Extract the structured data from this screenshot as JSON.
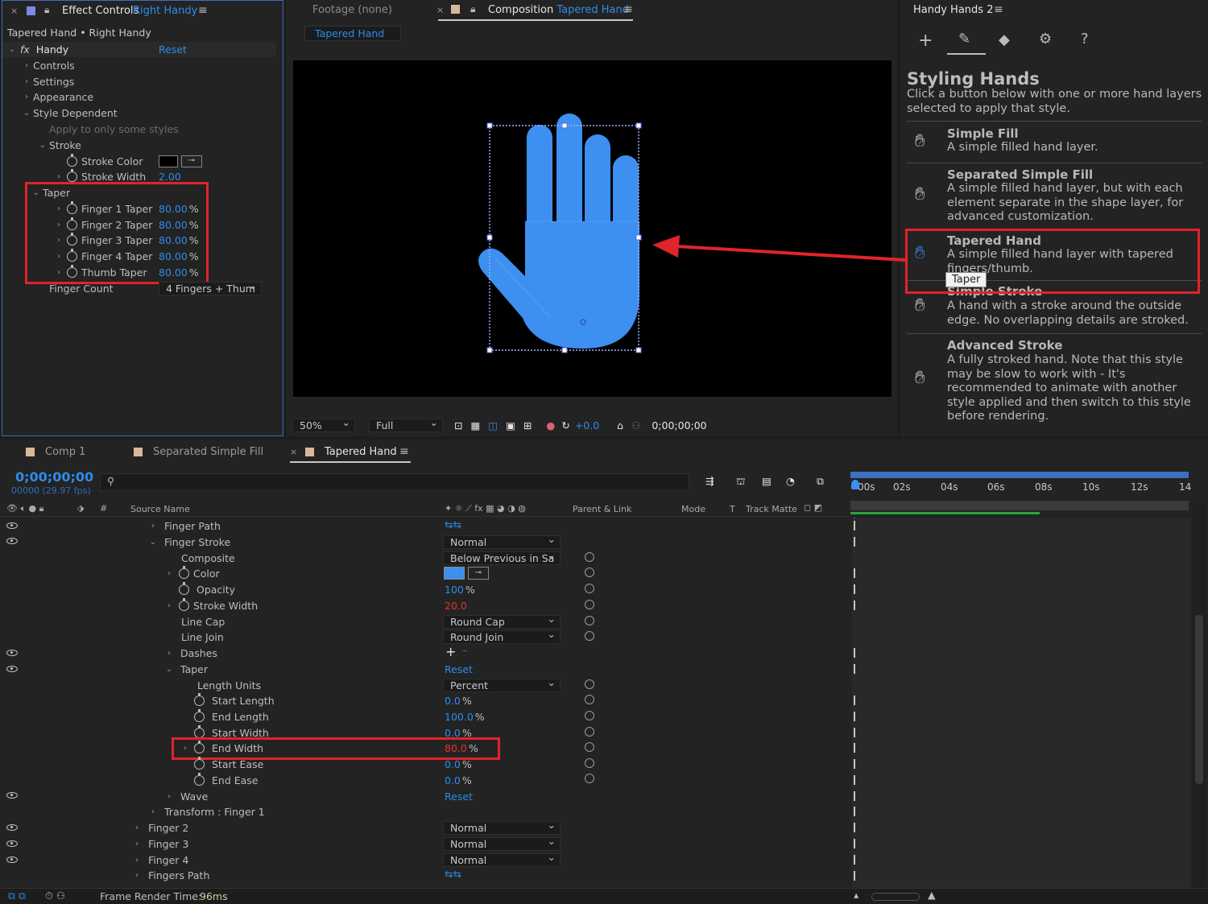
{
  "effect_controls": {
    "tab_title": "Effect Controls",
    "tab_layer": "Right Handy",
    "breadcrumb": "Tapered Hand • Right Handy",
    "fx_name": "Handy",
    "reset": "Reset",
    "groups": [
      "Controls",
      "Settings",
      "Appearance",
      "Style Dependent"
    ],
    "apply_note": "Apply to only some styles",
    "stroke_label": "Stroke",
    "stroke_color": "Stroke Color",
    "stroke_width": "Stroke Width",
    "stroke_width_val": "2.00",
    "taper_label": "Taper",
    "tapers": [
      {
        "label": "Finger 1 Taper",
        "value": "80.00",
        "unit": "%"
      },
      {
        "label": "Finger 2 Taper",
        "value": "80.00",
        "unit": "%"
      },
      {
        "label": "Finger 3 Taper",
        "value": "80.00",
        "unit": "%"
      },
      {
        "label": "Finger 4 Taper",
        "value": "80.00",
        "unit": "%"
      },
      {
        "label": "Thumb Taper",
        "value": "80.00",
        "unit": "%"
      }
    ],
    "finger_count_label": "Finger Count",
    "finger_count_val": "4 Fingers + Thum"
  },
  "viewer": {
    "footage_tab": "Footage (none)",
    "comp_tab_prefix": "Composition",
    "comp_tab_name": "Tapered Hand",
    "comp_chip": "Tapered Hand",
    "zoom": "50%",
    "resolution": "Full",
    "exposure": "+0.0",
    "timecode": "0;00;00;00"
  },
  "handy_panel": {
    "title": "Handy Hands 2",
    "heading": "Styling Hands",
    "intro": "Click a button below with one or more hand layers selected to apply that style.",
    "styles": [
      {
        "title": "Simple Fill",
        "desc": "A simple filled hand layer."
      },
      {
        "title": "Separated Simple Fill",
        "desc": "A simple filled hand layer, but with each element separate in the shape layer, for advanced customization."
      },
      {
        "title": "Tapered Hand",
        "desc": "A simple filled hand layer with tapered fingers/thumb."
      },
      {
        "title": "Simple Stroke",
        "desc": "A hand with a stroke around the outside edge. No overlapping details are stroked."
      },
      {
        "title": "Advanced Stroke",
        "desc": "A fully stroked hand. Note that this style may be slow to work with - It's recommended to animate with another style applied and then switch to this style before rendering."
      }
    ],
    "tooltip": "Taper"
  },
  "timeline": {
    "tabs": [
      "Comp 1",
      "Separated Simple Fill",
      "Tapered Hand"
    ],
    "timecode": "0;00;00;00",
    "fps": "00000 (29.97 fps)",
    "cols": {
      "source": "Source Name",
      "parent": "Parent & Link",
      "mode": "Mode",
      "t": "T",
      "matte": "Track Matte"
    },
    "ticks": [
      "00s",
      "02s",
      "04s",
      "06s",
      "08s",
      "10s",
      "12s",
      "14"
    ],
    "rows": {
      "finger_path": "Finger Path",
      "finger_stroke": "Finger Stroke",
      "finger_stroke_mode": "Normal",
      "composite": "Composite",
      "composite_val": "Below Previous in Sa",
      "color": "Color",
      "opacity": "Opacity",
      "opacity_val": "100",
      "stroke_width": "Stroke Width",
      "stroke_width_val": "20.0",
      "line_cap": "Line Cap",
      "line_cap_val": "Round Cap",
      "line_join": "Line Join",
      "line_join_val": "Round Join",
      "dashes": "Dashes",
      "taper": "Taper",
      "taper_reset": "Reset",
      "length_units": "Length Units",
      "length_units_val": "Percent",
      "start_length": "Start Length",
      "start_length_val": "0.0",
      "end_length": "End Length",
      "end_length_val": "100.0",
      "start_width": "Start Width",
      "start_width_val": "0.0",
      "end_width": "End Width",
      "end_width_val": "80.0",
      "start_ease": "Start Ease",
      "start_ease_val": "0.0",
      "end_ease": "End Ease",
      "end_ease_val": "0.0",
      "wave": "Wave",
      "wave_reset": "Reset",
      "transform": "Transform : Finger 1",
      "finger2": "Finger 2",
      "finger3": "Finger 3",
      "finger4": "Finger 4",
      "fingers_path": "Fingers Path",
      "normal": "Normal",
      "pct": "%"
    },
    "status_label": "Frame Render Time:",
    "status_value": "96ms"
  },
  "colors": {
    "accent": "#2d8ceb",
    "hand": "#3d8ff0",
    "highlight": "#e0242b"
  }
}
